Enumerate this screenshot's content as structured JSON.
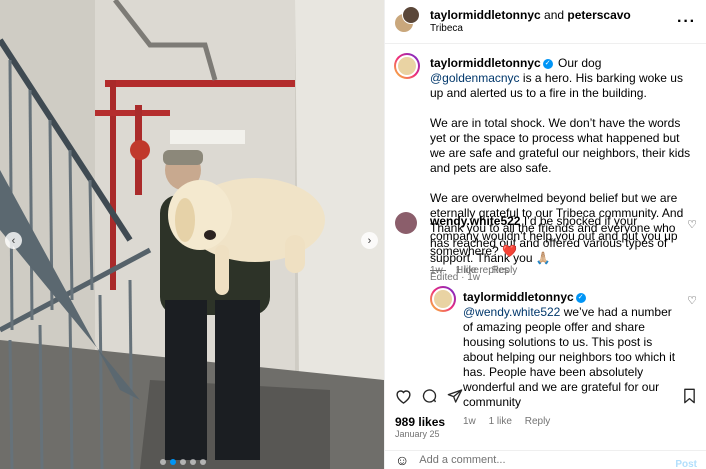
{
  "header": {
    "user1": "taylormiddletonnyc",
    "connector": " and ",
    "user2": "peterscavo",
    "location": "Tribeca",
    "more_icon": "more-horizontal-icon"
  },
  "caption": {
    "username": "taylormiddletonnyc",
    "p1_before": " Our dog ",
    "p1_mention": "@goldenmacnyc",
    "p1_after": " is a hero. His barking woke us up and alerted us to a fire in the building.",
    "p2": "We are in total shock. We don’t have the words yet or the space to process what happened but we are safe and grateful our neighbors, their kids and pets are also safe.",
    "p3": "We are overwhelmed beyond belief but we are eternally grateful to our Tribeca community. And Thank you to all the friends and everyone who has reached out and offered various types of support. Thank you 🙏🏼",
    "meta": "Edited · 1w"
  },
  "comments": [
    {
      "username": "wendy.white522",
      "text": " I’d be shocked if your company wouldn’t help you out and put you up somewhere? ❤️",
      "age": "1w",
      "likes": "1 like",
      "reply": "Reply"
    }
  ],
  "hide_replies": "Hide replies",
  "reply": {
    "username": "taylormiddletonnyc",
    "mention": "@wendy.white522",
    "text": " we’ve had a number of amazing people offer and share housing solutions to us. This post is about helping our neighbors too which it has. People have been absolutely wonderful and we are grateful for our community",
    "age": "1w",
    "likes": "1 like",
    "reply_label": "Reply"
  },
  "likes": "989 likes",
  "date": "January 25",
  "add_comment": {
    "placeholder": "Add a comment...",
    "post_label": "Post"
  },
  "colors": {
    "link": "#00376b",
    "accent": "#0095f6",
    "muted": "#737373",
    "heart_red": "#ed4956"
  }
}
